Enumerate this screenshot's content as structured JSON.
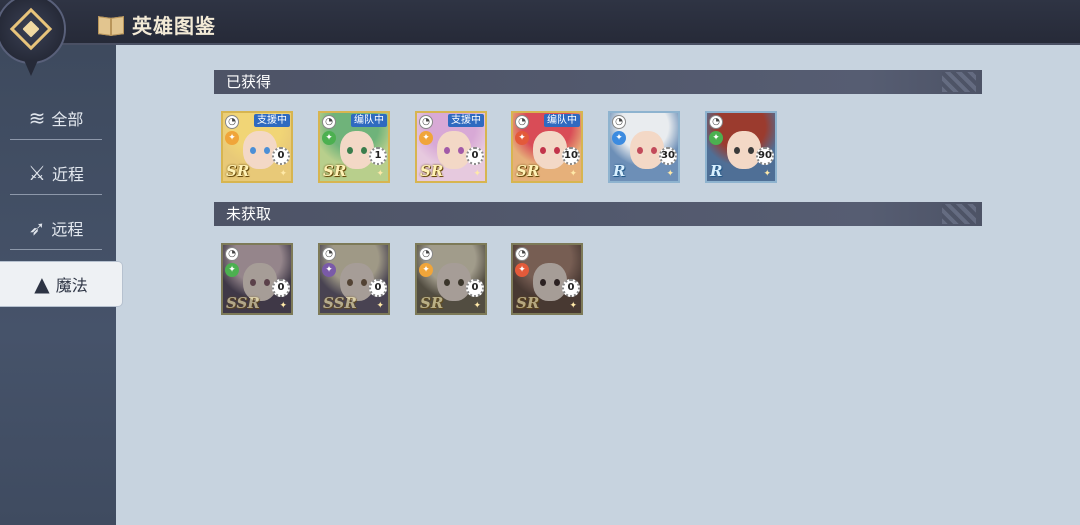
{
  "header": {
    "title": "英雄图鉴"
  },
  "sidebar": {
    "items": [
      {
        "label": "全部",
        "icon": "layers-icon"
      },
      {
        "label": "近程",
        "icon": "sword-icon"
      },
      {
        "label": "远程",
        "icon": "bow-icon"
      },
      {
        "label": "魔法",
        "icon": "witch-hat-icon",
        "active": true
      }
    ]
  },
  "sections": {
    "owned": {
      "title": "已获得",
      "cards": [
        {
          "rarity": "SR",
          "status": "支援中",
          "count": "0",
          "hair": "#f1d576",
          "bg": "#e8c978",
          "eyes": "#4b8fd6",
          "elem_color": "#f0a53a"
        },
        {
          "rarity": "SR",
          "status": "编队中",
          "count": "1",
          "hair": "#6fb37a",
          "bg": "#b8cf8c",
          "eyes": "#3a7d4c",
          "elem_color": "#4cb050"
        },
        {
          "rarity": "SR",
          "status": "支援中",
          "count": "0",
          "hair": "#d8a9d6",
          "bg": "#e6c9de",
          "eyes": "#a25aa8",
          "elem_color": "#f0a53a"
        },
        {
          "rarity": "SR",
          "status": "编队中",
          "count": "10",
          "hair": "#d94c57",
          "bg": "#e6b07a",
          "eyes": "#c2344a",
          "elem_color": "#e35a3a"
        },
        {
          "rarity": "R",
          "status": "",
          "count": "30",
          "hair": "#e9ecef",
          "bg": "#6d8fb7",
          "eyes": "#c24a5a",
          "elem_color": "#3c8be0"
        },
        {
          "rarity": "R",
          "status": "",
          "count": "90",
          "hair": "#9b3b2e",
          "bg": "#4f6f96",
          "eyes": "#3a3a3a",
          "elem_color": "#4cb050"
        }
      ]
    },
    "locked": {
      "title": "未获取",
      "cards": [
        {
          "rarity": "SSR",
          "count": "0",
          "hair": "#e2b3c5",
          "bg": "#5f4a78",
          "eyes": "#a0506a",
          "elem_color": "#4cb050"
        },
        {
          "rarity": "SSR",
          "count": "0",
          "hair": "#e8d49a",
          "bg": "#6a5a86",
          "eyes": "#8a5a2a",
          "elem_color": "#7a5aa8"
        },
        {
          "rarity": "SR",
          "count": "0",
          "hair": "#e9d8a6",
          "bg": "#7a6a46",
          "eyes": "#5a4a2a",
          "elem_color": "#f0a53a"
        },
        {
          "rarity": "SR",
          "count": "0",
          "hair": "#c97a5a",
          "bg": "#7a4a36",
          "eyes": "#4a2a2a",
          "elem_color": "#e35a3a"
        }
      ]
    }
  }
}
